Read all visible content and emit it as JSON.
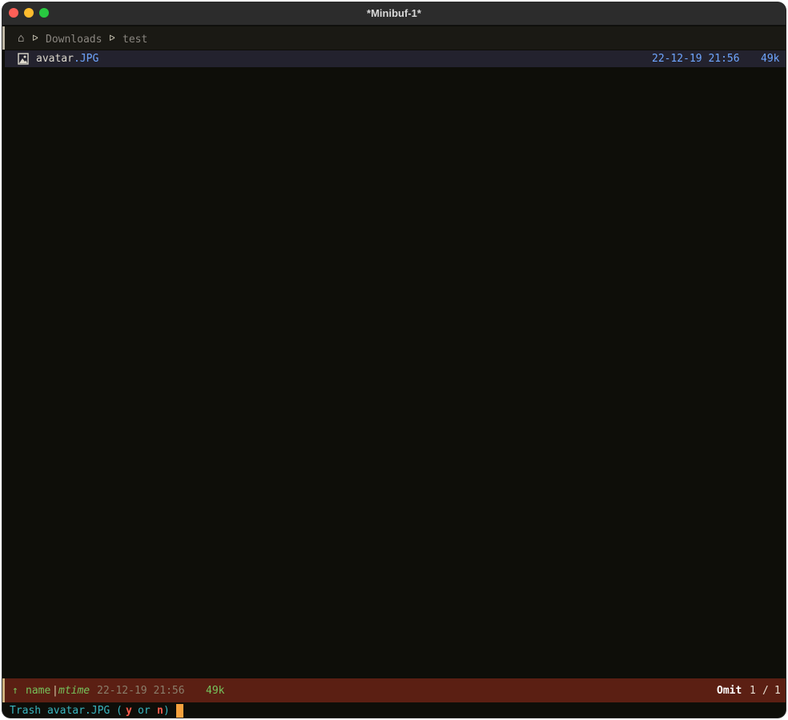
{
  "window": {
    "title": "*Minibuf-1*"
  },
  "breadcrumb": {
    "home_icon": "⌂",
    "separator": "ᐅ",
    "segments": [
      "Downloads",
      "test"
    ]
  },
  "files": [
    {
      "icon": "image-file-icon",
      "name_base": "avatar",
      "name_ext": ".JPG",
      "mtime": "22-12-19 21:56",
      "size": "49k"
    }
  ],
  "modeline": {
    "sort_arrow": "↑",
    "sort_name": "name",
    "sort_sep": "|",
    "sort_mtime": "mtime",
    "date": "22-12-19 21:56",
    "size": "49k",
    "omit_label": "Omit",
    "position": "1",
    "position_sep": "/",
    "total": "1"
  },
  "minibuffer": {
    "prompt_prefix": "Trash avatar.JPG (",
    "yes_key": "y",
    "or_word": "or",
    "no_key": "n",
    "prompt_suffix": ")"
  },
  "colors": {
    "background": "#0e0e09",
    "accent_blue": "#6fa6ff",
    "modeline_bg": "#5b1f13",
    "green": "#76c35c",
    "cyan": "#39b6c0",
    "cursor": "#f5a13d"
  }
}
